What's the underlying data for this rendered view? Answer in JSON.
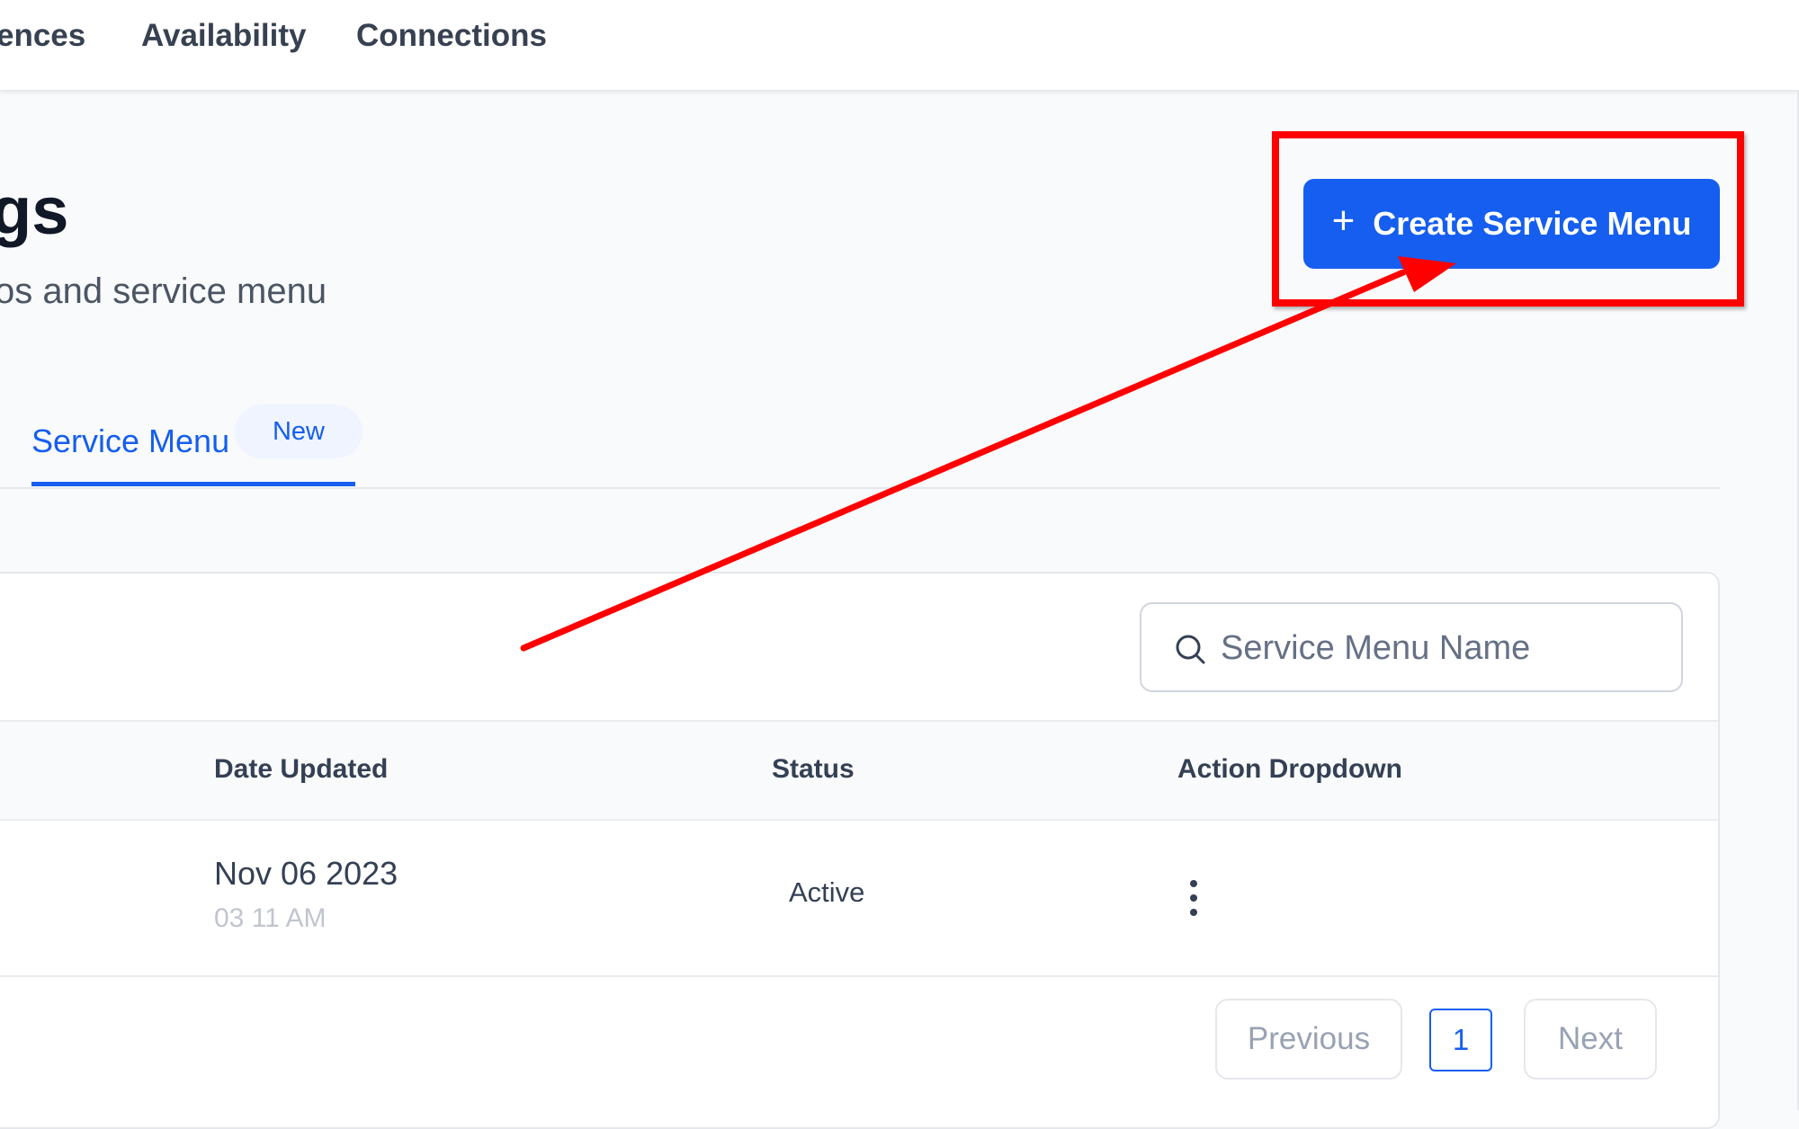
{
  "nav": {
    "items": [
      {
        "label": "ences"
      },
      {
        "label": "Availability"
      },
      {
        "label": "Connections"
      }
    ]
  },
  "header": {
    "title": "gs",
    "subtitle": "os and service menu",
    "create_button_label": "Create Service Menu",
    "create_button_icon": "plus-icon"
  },
  "tabs": [
    {
      "label": "Service Menu",
      "badge": "New",
      "active": true
    }
  ],
  "search": {
    "placeholder": "Service Menu Name",
    "value": "",
    "icon": "search-icon"
  },
  "table": {
    "columns": [
      "Date Updated",
      "Status",
      "Action Dropdown"
    ],
    "rows": [
      {
        "date": "Nov 06 2023",
        "time": "03 11 AM",
        "status": "Active",
        "action_icon": "kebab-menu-icon"
      }
    ]
  },
  "pagination": {
    "previous_label": "Previous",
    "current_page": "1",
    "next_label": "Next"
  },
  "annotation": {
    "box_color": "#ff0000",
    "arrow_color": "#ff0000"
  },
  "colors": {
    "primary": "#155eef",
    "background": "#f9fafb"
  }
}
